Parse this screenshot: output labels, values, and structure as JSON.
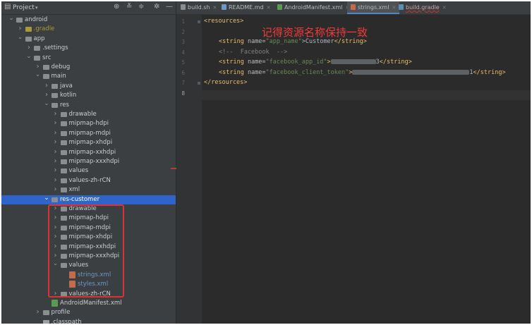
{
  "project_panel": {
    "title": "Project",
    "tree": [
      {
        "label": "android",
        "kind": "folder",
        "arrow": "v",
        "depth": 0,
        "style": "normal"
      },
      {
        "label": ".gradle",
        "kind": "folder",
        "arrow": ">",
        "depth": 1,
        "style": "gradle"
      },
      {
        "label": "app",
        "kind": "folder",
        "arrow": "v",
        "depth": 1,
        "style": "normal"
      },
      {
        "label": ".settings",
        "kind": "folder",
        "arrow": ">",
        "depth": 2,
        "style": "normal"
      },
      {
        "label": "src",
        "kind": "folder",
        "arrow": "v",
        "depth": 2,
        "style": "normal"
      },
      {
        "label": "debug",
        "kind": "folder",
        "arrow": ">",
        "depth": 3,
        "style": "normal"
      },
      {
        "label": "main",
        "kind": "folder",
        "arrow": "v",
        "depth": 3,
        "style": "normal"
      },
      {
        "label": "java",
        "kind": "folder",
        "arrow": ">",
        "depth": 4,
        "style": "normal"
      },
      {
        "label": "kotlin",
        "kind": "folder",
        "arrow": ">",
        "depth": 4,
        "style": "normal"
      },
      {
        "label": "res",
        "kind": "folder",
        "arrow": "v",
        "depth": 4,
        "style": "normal"
      },
      {
        "label": "drawable",
        "kind": "folder",
        "arrow": ">",
        "depth": 5,
        "style": "normal"
      },
      {
        "label": "mipmap-hdpi",
        "kind": "folder",
        "arrow": ">",
        "depth": 5,
        "style": "normal"
      },
      {
        "label": "mipmap-mdpi",
        "kind": "folder",
        "arrow": ">",
        "depth": 5,
        "style": "normal"
      },
      {
        "label": "mipmap-xhdpi",
        "kind": "folder",
        "arrow": ">",
        "depth": 5,
        "style": "normal"
      },
      {
        "label": "mipmap-xxhdpi",
        "kind": "folder",
        "arrow": ">",
        "depth": 5,
        "style": "normal"
      },
      {
        "label": "mipmap-xxxhdpi",
        "kind": "folder",
        "arrow": ">",
        "depth": 5,
        "style": "normal"
      },
      {
        "label": "values",
        "kind": "folder",
        "arrow": ">",
        "depth": 5,
        "style": "normal"
      },
      {
        "label": "values-zh-rCN",
        "kind": "folder",
        "arrow": ">",
        "depth": 5,
        "style": "normal"
      },
      {
        "label": "xml",
        "kind": "folder",
        "arrow": ">",
        "depth": 5,
        "style": "normal"
      },
      {
        "label": "res-customer",
        "kind": "folder",
        "arrow": "v",
        "depth": 4,
        "style": "selected"
      },
      {
        "label": "drawable",
        "kind": "folder",
        "arrow": ">",
        "depth": 5,
        "style": "normal"
      },
      {
        "label": "mipmap-hdpi",
        "kind": "folder",
        "arrow": ">",
        "depth": 5,
        "style": "normal"
      },
      {
        "label": "mipmap-mdpi",
        "kind": "folder",
        "arrow": ">",
        "depth": 5,
        "style": "normal"
      },
      {
        "label": "mipmap-xhdpi",
        "kind": "folder",
        "arrow": ">",
        "depth": 5,
        "style": "normal"
      },
      {
        "label": "mipmap-xxhdpi",
        "kind": "folder",
        "arrow": ">",
        "depth": 5,
        "style": "normal"
      },
      {
        "label": "mipmap-xxxhdpi",
        "kind": "folder",
        "arrow": ">",
        "depth": 5,
        "style": "normal"
      },
      {
        "label": "values",
        "kind": "folder",
        "arrow": "v",
        "depth": 5,
        "style": "normal"
      },
      {
        "label": "strings.xml",
        "kind": "xml",
        "arrow": "",
        "depth": 6,
        "style": "xml"
      },
      {
        "label": "styles.xml",
        "kind": "xml",
        "arrow": "",
        "depth": 6,
        "style": "xml"
      },
      {
        "label": "values-zh-rCN",
        "kind": "folder",
        "arrow": ">",
        "depth": 5,
        "style": "normal"
      },
      {
        "label": "AndroidManifest.xml",
        "kind": "manifest",
        "arrow": "",
        "depth": 4,
        "style": "normal"
      },
      {
        "label": "profile",
        "kind": "folder",
        "arrow": ">",
        "depth": 3,
        "style": "normal"
      },
      {
        "label": ".classpath",
        "kind": "file",
        "arrow": "",
        "depth": 3,
        "style": "normal"
      }
    ]
  },
  "tabs": [
    {
      "label": "build.sh",
      "icon_color": "#8a8e91",
      "active": false
    },
    {
      "label": "README.md",
      "icon_color": "#6c97c8",
      "active": false
    },
    {
      "label": "AndroidManifest.xml",
      "icon_color": "#5a9a52",
      "active": false
    },
    {
      "label": "strings.xml",
      "icon_color": "#c46b4c",
      "active": true
    },
    {
      "label": "build.gradle",
      "icon_color": "#5a8fb0",
      "active": false
    }
  ],
  "editor": {
    "line_numbers": [
      "1",
      "2",
      "3",
      "4",
      "5",
      "6",
      "7",
      "8"
    ],
    "current_line": "8",
    "annotation": "记得资源名称保持一致",
    "lines": {
      "l1_open": "<resources>",
      "l3_tag_open": "<string ",
      "l3_attr": "name=",
      "l3_val": "\"app_name\"",
      "l3_text": ">Customer",
      "l3_tag_close": "</string>",
      "l4_comment": "<!--  Facebook  -->",
      "l5_tag_open": "<string ",
      "l5_attr": "name=",
      "l5_val": "\"facebook_app_id\"",
      "l5_visible": "3",
      "l5_tag_close": "</string>",
      "l6_tag_open": "<string ",
      "l6_attr": "name=",
      "l6_val": "\"facebook_client_token\"",
      "l6_visible": "1",
      "l6_tag_close": "</string>",
      "l7_close": "</resources>"
    }
  },
  "colors": {
    "selection": "#2f65ca",
    "annotation": "#ef3a3a",
    "highlight_box": "#e03131"
  }
}
